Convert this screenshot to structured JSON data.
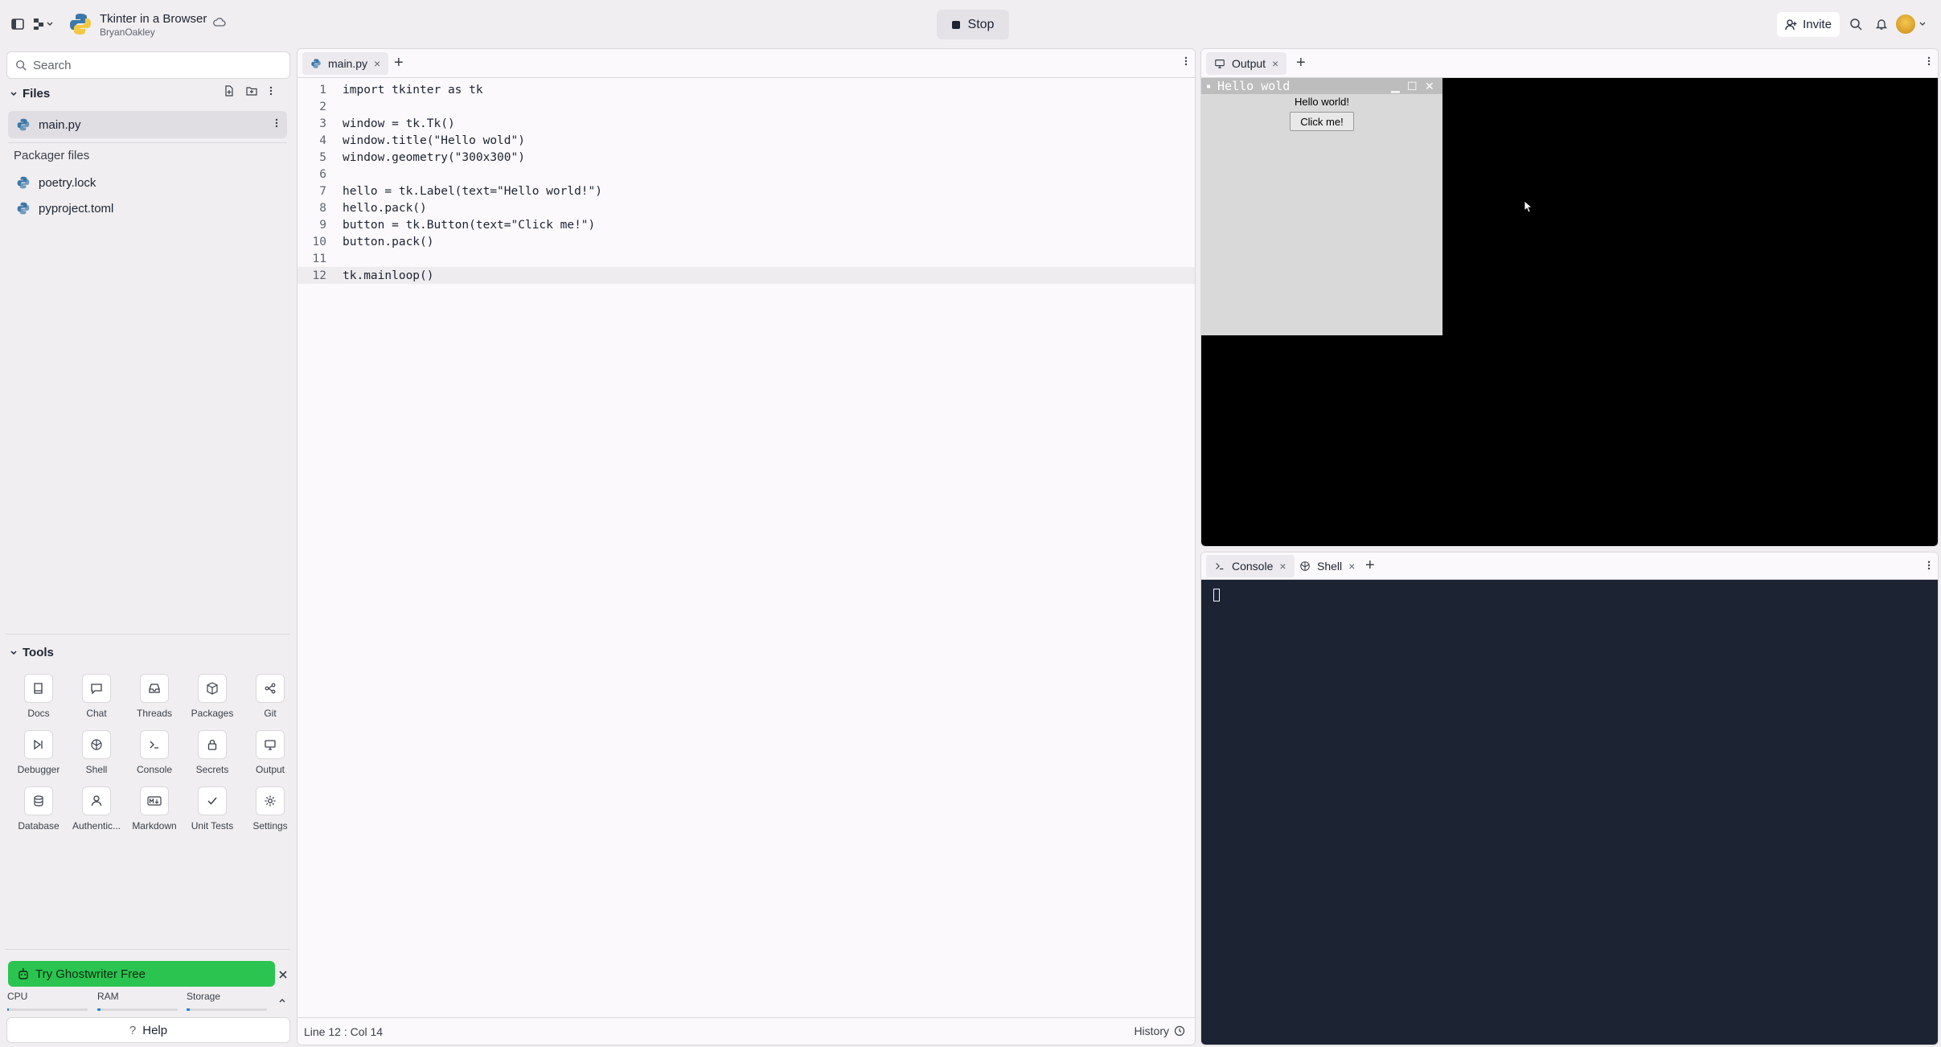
{
  "topbar": {
    "repl_title": "Tkinter in a Browser",
    "repl_owner": "BryanOakley",
    "stop_label": "Stop",
    "invite_label": "Invite"
  },
  "files": {
    "search_placeholder": "Search",
    "section_title": "Files",
    "items": [
      {
        "name": "main.py"
      }
    ],
    "packager_title": "Packager files",
    "packager_items": [
      {
        "name": "poetry.lock"
      },
      {
        "name": "pyproject.toml"
      }
    ]
  },
  "tools": {
    "section_title": "Tools",
    "items": [
      {
        "label": "Docs",
        "icon": "book-icon"
      },
      {
        "label": "Chat",
        "icon": "chat-icon"
      },
      {
        "label": "Threads",
        "icon": "inbox-icon"
      },
      {
        "label": "Packages",
        "icon": "package-icon"
      },
      {
        "label": "Git",
        "icon": "git-icon"
      },
      {
        "label": "Debugger",
        "icon": "debugger-icon"
      },
      {
        "label": "Shell",
        "icon": "shell-icon"
      },
      {
        "label": "Console",
        "icon": "console-icon"
      },
      {
        "label": "Secrets",
        "icon": "lock-icon"
      },
      {
        "label": "Output",
        "icon": "monitor-icon"
      },
      {
        "label": "Database",
        "icon": "database-icon"
      },
      {
        "label": "Authentic...",
        "icon": "user-icon"
      },
      {
        "label": "Markdown",
        "icon": "markdown-icon"
      },
      {
        "label": "Unit Tests",
        "icon": "check-icon"
      },
      {
        "label": "Settings",
        "icon": "gear-icon"
      }
    ]
  },
  "footer": {
    "ghostwriter_label": "Try Ghostwriter Free",
    "cpu_label": "CPU",
    "ram_label": "RAM",
    "storage_label": "Storage",
    "cpu_fraction": 0.02,
    "ram_fraction": 0.04,
    "storage_fraction": 0.04,
    "help_label": "Help"
  },
  "editor": {
    "tab_label": "main.py",
    "lines": [
      "import tkinter as tk",
      "",
      "window = tk.Tk()",
      "window.title(\"Hello wold\")",
      "window.geometry(\"300x300\")",
      "",
      "hello = tk.Label(text=\"Hello world!\")",
      "hello.pack()",
      "button = tk.Button(text=\"Click me!\")",
      "button.pack()",
      "",
      "tk.mainloop()"
    ],
    "current_line": 12,
    "status": "Line 12 : Col 14",
    "history_label": "History"
  },
  "output": {
    "tab_label": "Output",
    "tk_window_title": "Hello wold",
    "tk_label": "Hello world!",
    "tk_button": "Click me!"
  },
  "console": {
    "tab_console": "Console",
    "tab_shell": "Shell"
  },
  "colors": {
    "accent": "#0079f2",
    "ghostwriter": "#2bc450",
    "console_bg": "#1c2333"
  }
}
